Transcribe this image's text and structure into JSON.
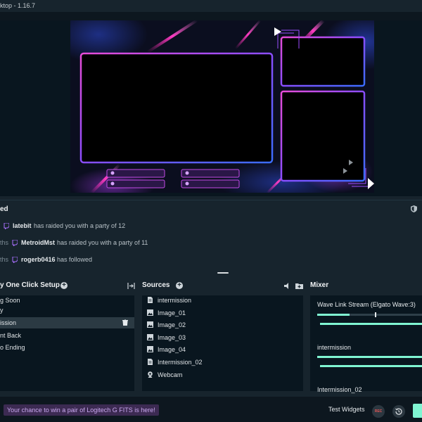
{
  "window": {
    "title": "ktop - 1.16.7"
  },
  "events": {
    "title": "ed",
    "items": [
      {
        "time": "",
        "user": "latebit",
        "action": "has raided you with a party of 12"
      },
      {
        "time": "ths",
        "user": "MetroidMst",
        "action": "has raided you with a party of 11"
      },
      {
        "time": "ths",
        "user": "rogerb0416",
        "action": "has followed"
      }
    ]
  },
  "scenes": {
    "title": "y One Click Setup",
    "items": [
      "g Soon",
      "y",
      "ission",
      "nt Back",
      "o Ending"
    ],
    "active_index": 2
  },
  "sources": {
    "title": "Sources",
    "items": [
      {
        "label": "intermission",
        "icon": "file-icon"
      },
      {
        "label": "Image_01",
        "icon": "image-icon"
      },
      {
        "label": "Image_02",
        "icon": "image-icon"
      },
      {
        "label": "Image_03",
        "icon": "image-icon"
      },
      {
        "label": "Image_04",
        "icon": "image-icon"
      },
      {
        "label": "Intermission_02",
        "icon": "file-icon"
      },
      {
        "label": "Webcam",
        "icon": "webcam-icon"
      }
    ]
  },
  "mixer": {
    "title": "Mixer",
    "channels": [
      {
        "label": "Wave Link Stream (Elgato Wave:3)"
      },
      {
        "label": "intermission"
      },
      {
        "label": "Intermission_02"
      }
    ]
  },
  "footer": {
    "promo": "Your chance to win a pair of Logitech G FITS is here!",
    "test_widgets": "Test Widgets",
    "rec": "REC"
  },
  "colors": {
    "accent": "#80f5d2",
    "twitch": "#a970ff",
    "frame_blue": "#3a6dff",
    "frame_pink": "#e84cd7"
  }
}
